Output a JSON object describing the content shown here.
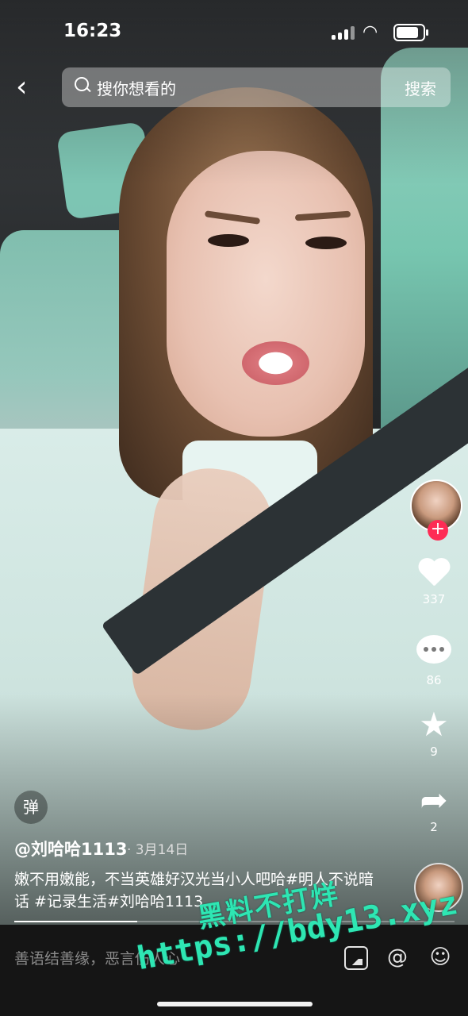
{
  "status_bar": {
    "time": "16:23",
    "battery_level": 0.9
  },
  "search": {
    "placeholder": "搜你想看的",
    "button_label": "搜索"
  },
  "rail": {
    "likes": "337",
    "comments": "86",
    "favorites": "9",
    "shares": "2",
    "follow_glyph": "+"
  },
  "video": {
    "danmu_label": "弹",
    "author": "@刘哈哈1113",
    "date": "· 3月14日",
    "description": "嫩不用嫩能，不当英雄好汉光当小人吧哈#明人不说暗话 #记录生活#刘哈哈1113",
    "progress": 0.28
  },
  "bottom_bar": {
    "comment_placeholder": "善语结善缘，恶言伤人心"
  },
  "watermark": {
    "line1": "黑料不打烊",
    "line2": "https://bdy13.xyz"
  },
  "colors": {
    "follow": "#fe2c55",
    "watermark": "#2ee6b3"
  },
  "icons": [
    "back-icon",
    "search-icon",
    "heart-icon",
    "comment-icon",
    "star-icon",
    "share-icon",
    "image-icon",
    "at-icon",
    "emoji-icon"
  ]
}
